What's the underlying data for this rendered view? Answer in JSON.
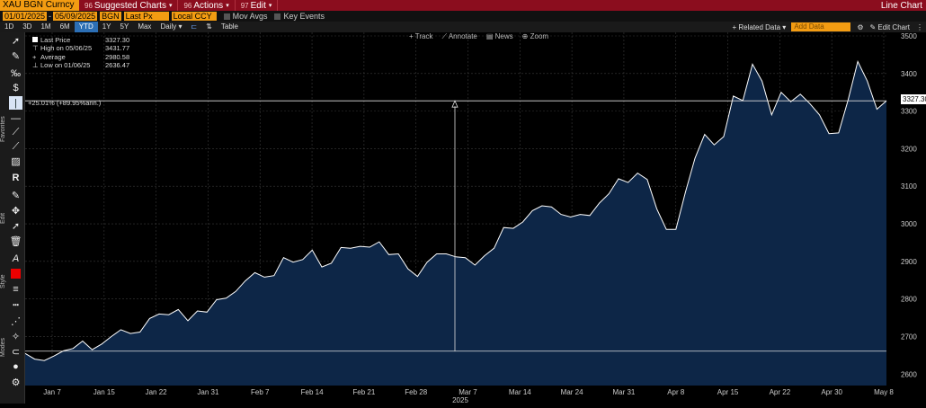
{
  "topbar": {
    "ticker": "XAU BGN Curncy",
    "menus": [
      {
        "num": "96",
        "label": "Suggested Charts"
      },
      {
        "num": "96",
        "label": "Actions"
      },
      {
        "num": "97",
        "label": "Edit"
      }
    ],
    "right_title": "Line Chart"
  },
  "row2": {
    "start_date": "01/01/2025",
    "end_date": "05/09/2025",
    "source": "BGN",
    "field": "Last Px",
    "currency": "Local CCY",
    "mov_avgs": "Mov Avgs",
    "key_events": "Key Events"
  },
  "row3": {
    "ranges": [
      "1D",
      "3D",
      "1M",
      "6M",
      "YTD",
      "1Y",
      "5Y",
      "Max"
    ],
    "active_range": "YTD",
    "frequency": "Daily",
    "table": "Table",
    "related": "Related Data",
    "add_data_placeholder": "Add Data",
    "edit_chart": "Edit Chart"
  },
  "toolbar": {
    "labels": [
      "Favorites",
      "Edit",
      "Style",
      "Modes"
    ]
  },
  "annotate_bar": [
    "Track",
    "Annotate",
    "News",
    "Zoom"
  ],
  "legend": {
    "rows": [
      {
        "name": "Last Price",
        "value": "3327.30"
      },
      {
        "name": "High on 05/06/25",
        "value": "3431.77"
      },
      {
        "name": "Average",
        "value": "2980.58"
      },
      {
        "name": "Low on 01/06/25",
        "value": "2636.47"
      }
    ]
  },
  "change_label": "+25.01% (+89.95%ann.)",
  "last_badge": "3327.30",
  "colors": {
    "line": "#ffffff",
    "fill": "#0d2647",
    "grid": "#3a3a3a",
    "accent": "#f39c12",
    "brand": "#8b0d1e"
  },
  "chart_data": {
    "type": "area",
    "ylim": [
      2560,
      3500
    ],
    "yticks": [
      2600,
      2700,
      2800,
      2900,
      3000,
      3100,
      3200,
      3300,
      3400,
      3500
    ],
    "xticks": [
      "Jan 7",
      "Jan 15",
      "Jan 22",
      "Jan 31",
      "Feb 7",
      "Feb 14",
      "Feb 21",
      "Feb 28",
      "Mar 7",
      "Mar 14",
      "Mar 24",
      "Mar 31",
      "Apr 8",
      "Apr 15",
      "Apr 22",
      "Apr 30",
      "May 8"
    ],
    "year_label": "2025",
    "values": [
      2655,
      2640,
      2636,
      2648,
      2662,
      2668,
      2688,
      2665,
      2680,
      2700,
      2718,
      2708,
      2712,
      2748,
      2760,
      2758,
      2772,
      2742,
      2768,
      2765,
      2798,
      2802,
      2820,
      2848,
      2870,
      2858,
      2862,
      2910,
      2898,
      2905,
      2930,
      2885,
      2895,
      2937,
      2935,
      2940,
      2938,
      2952,
      2918,
      2920,
      2880,
      2860,
      2898,
      2920,
      2920,
      2912,
      2910,
      2890,
      2915,
      2935,
      2990,
      2988,
      3005,
      3035,
      3048,
      3045,
      3025,
      3018,
      3025,
      3022,
      3055,
      3080,
      3120,
      3110,
      3135,
      3118,
      3040,
      2985,
      2985,
      3085,
      3175,
      3238,
      3210,
      3232,
      3340,
      3328,
      3425,
      3380,
      3290,
      3350,
      3325,
      3345,
      3320,
      3290,
      3240,
      3242,
      3330,
      3432,
      3380,
      3305,
      3327
    ]
  }
}
